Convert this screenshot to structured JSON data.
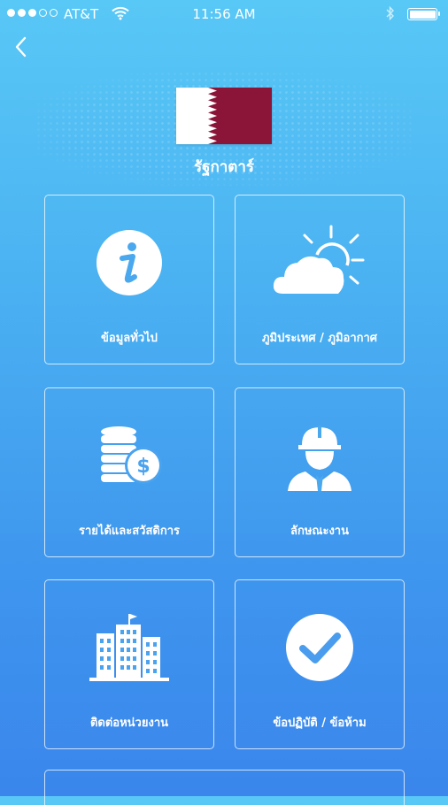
{
  "status_bar": {
    "carrier": "AT&T",
    "time": "11:56 AM"
  },
  "country": {
    "name": "รัฐกาตาร์",
    "flag_colors": {
      "white": "#ffffff",
      "maroon": "#8a1538"
    }
  },
  "menu": {
    "items": [
      {
        "label": "ข้อมูลทั่วไป",
        "icon": "info-icon"
      },
      {
        "label": "ภูมิประเทศ / ภูมิอากาศ",
        "icon": "weather-icon"
      },
      {
        "label": "รายได้และสวัสดิการ",
        "icon": "coins-dollar-icon"
      },
      {
        "label": "ลักษณะงาน",
        "icon": "worker-icon"
      },
      {
        "label": "ติดต่อหน่วยงาน",
        "icon": "buildings-icon"
      },
      {
        "label": "ข้อปฏิบัติ / ข้อห้าม",
        "icon": "check-icon"
      }
    ]
  },
  "colors": {
    "gradient_top": "#58c8f6",
    "gradient_bottom": "#3a86ec"
  }
}
